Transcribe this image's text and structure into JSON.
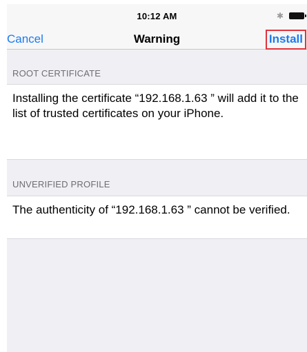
{
  "status_bar": {
    "time": "10:12 AM",
    "bluetooth_symbol": "✱"
  },
  "nav": {
    "cancel_label": "Cancel",
    "title": "Warning",
    "install_label": "Install",
    "highlight_color": "#e2323b",
    "accent_color": "#1a7bf2"
  },
  "sections": {
    "root": {
      "header": "ROOT CERTIFICATE",
      "body": "Installing the certificate “192.168.1.63 ” will add it to the list of trusted certificates on your iPhone."
    },
    "unverified": {
      "header": "UNVERIFIED PROFILE",
      "body": "The authenticity of “192.168.1.63 ” cannot be verified."
    }
  },
  "icons": [
    "bluetooth-icon",
    "battery-icon"
  ]
}
